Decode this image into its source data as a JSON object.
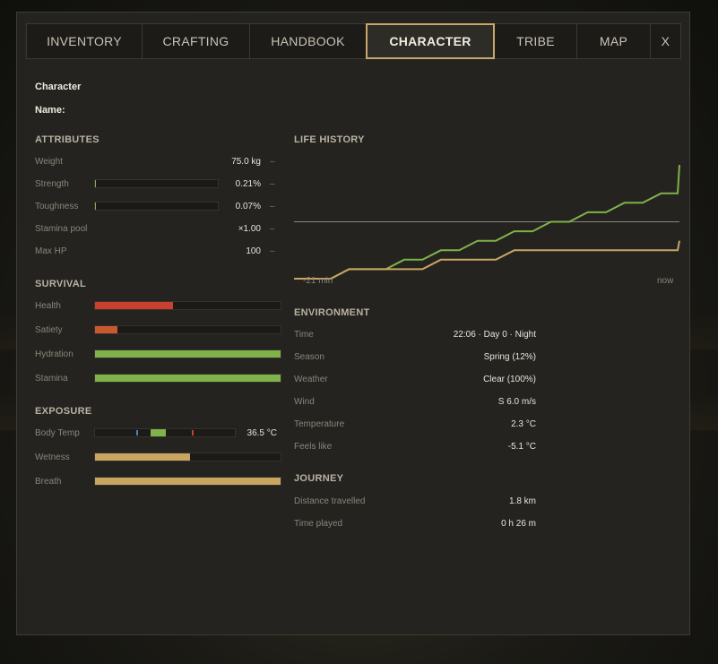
{
  "tabs": [
    {
      "label": "INVENTORY"
    },
    {
      "label": "CRAFTING"
    },
    {
      "label": "HANDBOOK"
    },
    {
      "label": "CHARACTER"
    },
    {
      "label": "TRIBE"
    },
    {
      "label": "MAP"
    },
    {
      "label": "X"
    }
  ],
  "character": {
    "header": "Character",
    "name_label": "Name:"
  },
  "attributes": {
    "title": "ATTRIBUTES",
    "weight": {
      "label": "Weight",
      "value": "75.0 kg",
      "action": "–"
    },
    "strength": {
      "label": "Strength",
      "value": "0.21%",
      "action": "–",
      "fraction": 0.0021
    },
    "toughness": {
      "label": "Toughness",
      "value": "0.07%",
      "action": "–",
      "fraction": 0.0007
    },
    "stamina_pool": {
      "label": "Stamina pool",
      "value": "×1.00",
      "action": "–"
    },
    "max_hp": {
      "label": "Max HP",
      "value": "100",
      "action": "–"
    }
  },
  "survival": {
    "title": "SURVIVAL",
    "health": {
      "label": "Health",
      "fraction": 0.42,
      "color": "#c9402f"
    },
    "satiety": {
      "label": "Satiety",
      "fraction": 0.12,
      "color": "#c9582f"
    },
    "hydration": {
      "label": "Hydration",
      "fraction": 1.0,
      "color": "#7fb24a"
    },
    "stamina": {
      "label": "Stamina",
      "fraction": 1.0,
      "color": "#7fb24a"
    }
  },
  "exposure": {
    "title": "EXPOSURE",
    "body_temp": {
      "label": "Body Temp",
      "value": "36.5 °C",
      "level": 0.5,
      "cold_color": "#4a7fc9",
      "hot_color": "#c9402f",
      "ok_color": "#7fb24a"
    },
    "wetness": {
      "label": "Wetness",
      "fraction": 0.51,
      "color": "#c9a562"
    },
    "breath": {
      "label": "Breath",
      "fraction": 1.0,
      "color": "#c9a562"
    }
  },
  "life_history": {
    "title": "LIFE HISTORY",
    "x_start_label": "-21 min",
    "x_end_label": "now"
  },
  "chart_data": {
    "type": "line",
    "x_range": [
      -21,
      0
    ],
    "series": [
      {
        "color": "#7fb24a",
        "values": [
          [
            -21,
            0
          ],
          [
            -19,
            0
          ],
          [
            -18,
            1
          ],
          [
            -16,
            1
          ],
          [
            -15,
            2
          ],
          [
            -14,
            2
          ],
          [
            -13,
            3
          ],
          [
            -12,
            3
          ],
          [
            -11,
            4
          ],
          [
            -10,
            4
          ],
          [
            -9,
            5
          ],
          [
            -8,
            5
          ],
          [
            -7,
            6
          ],
          [
            -6,
            6
          ],
          [
            -5,
            7
          ],
          [
            -4,
            7
          ],
          [
            -3,
            8
          ],
          [
            -2,
            8
          ],
          [
            -1,
            9
          ],
          [
            -0.1,
            9
          ],
          [
            0,
            12
          ]
        ]
      },
      {
        "color": "#c9a562",
        "values": [
          [
            -21,
            0
          ],
          [
            -19,
            0
          ],
          [
            -18,
            1
          ],
          [
            -14,
            1
          ],
          [
            -13,
            2
          ],
          [
            -10,
            2
          ],
          [
            -9,
            3
          ],
          [
            -4,
            3
          ],
          [
            -0.1,
            3
          ],
          [
            0,
            4
          ]
        ]
      }
    ],
    "reference_line": {
      "color": "#8a857a",
      "level": 0.5
    }
  },
  "environment": {
    "title": "ENVIRONMENT",
    "rows": [
      {
        "label": "Time",
        "value": "22:06 · Day 0 · Night"
      },
      {
        "label": "Season",
        "value": "Spring (12%)"
      },
      {
        "label": "Weather",
        "value": "Clear (100%)"
      },
      {
        "label": "Wind",
        "value": "S 6.0 m/s"
      },
      {
        "label": "Temperature",
        "value": "2.3 °C"
      },
      {
        "label": "Feels like",
        "value": "-5.1 °C"
      }
    ]
  },
  "journey": {
    "title": "JOURNEY",
    "rows": [
      {
        "label": "Distance travelled",
        "value": "1.8 km"
      },
      {
        "label": "Time played",
        "value": "0 h 26 m"
      }
    ]
  }
}
